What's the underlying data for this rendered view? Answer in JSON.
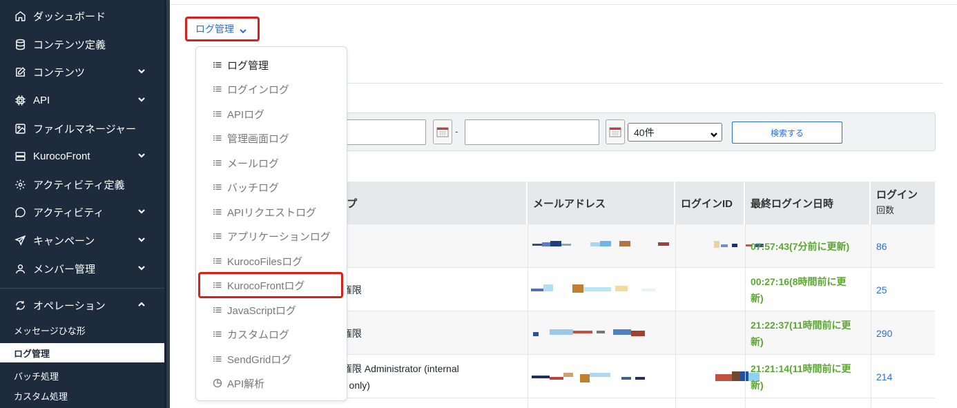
{
  "sidebar": {
    "items": [
      {
        "label": "ダッシュボード",
        "icon": "home-icon",
        "expandable": false
      },
      {
        "label": "コンテンツ定義",
        "icon": "database-icon",
        "expandable": false
      },
      {
        "label": "コンテンツ",
        "icon": "edit-icon",
        "expandable": true
      },
      {
        "label": "API",
        "icon": "chip-icon",
        "expandable": true
      },
      {
        "label": "ファイルマネージャー",
        "icon": "image-icon",
        "expandable": false
      },
      {
        "label": "KurocoFront",
        "icon": "server-icon",
        "expandable": true
      },
      {
        "label": "アクティビティ定義",
        "icon": "gear-icon",
        "expandable": false
      },
      {
        "label": "アクティビティ",
        "icon": "chat-icon",
        "expandable": true
      },
      {
        "label": "キャンペーン",
        "icon": "send-icon",
        "expandable": true
      },
      {
        "label": "メンバー管理",
        "icon": "user-icon",
        "expandable": true
      }
    ],
    "operation": {
      "label": "オペレーション",
      "icon": "refresh-icon"
    },
    "sub_items": [
      {
        "label": "メッセージひな形",
        "active": false
      },
      {
        "label": "ログ管理",
        "active": true
      },
      {
        "label": "バッチ処理",
        "active": false
      },
      {
        "label": "カスタム処理",
        "active": false
      }
    ]
  },
  "page_dropdown": {
    "label": "ログ管理"
  },
  "dropdown_menu": {
    "items": [
      {
        "label": "ログ管理",
        "icon": "list-icon",
        "current": true
      },
      {
        "label": "ログインログ",
        "icon": "list-icon"
      },
      {
        "label": "APIログ",
        "icon": "list-icon"
      },
      {
        "label": "管理画面ログ",
        "icon": "list-icon"
      },
      {
        "label": "メールログ",
        "icon": "list-icon"
      },
      {
        "label": "バッチログ",
        "icon": "list-icon"
      },
      {
        "label": "APIリクエストログ",
        "icon": "list-icon"
      },
      {
        "label": "アプリケーションログ",
        "icon": "list-icon"
      },
      {
        "label": "KurocoFilesログ",
        "icon": "list-icon"
      },
      {
        "label": "KurocoFrontログ",
        "icon": "list-icon",
        "highlighted": true
      },
      {
        "label": "JavaScriptログ",
        "icon": "list-icon"
      },
      {
        "label": "カスタムログ",
        "icon": "list-icon"
      },
      {
        "label": "SendGridログ",
        "icon": "list-icon"
      },
      {
        "label": "API解析",
        "icon": "pie-chart-icon"
      }
    ]
  },
  "filter": {
    "separator": "-",
    "per_page": "40件",
    "search_button": "検索する"
  },
  "table": {
    "headers": {
      "group": "グループ",
      "email": "メールアドレス",
      "login_id": "ログインID",
      "last_login": "最終ログイン日時",
      "login_count_1": "ログイン",
      "login_count_2": "回数"
    },
    "rows": [
      {
        "group": "",
        "last_login_1": "07:57:43(7分前に更新)",
        "last_login_2": "",
        "count": "86"
      },
      {
        "group": "編集権限",
        "last_login_1": "00:27:16(8時間前に更",
        "last_login_2": "新)",
        "count": "25"
      },
      {
        "group": "編集権限",
        "last_login_1": "21:22:37(11時間前に更",
        "last_login_2": "新)",
        "count": "290"
      },
      {
        "group": "編集権限 Administrator (internal",
        "group_2": "rk only)",
        "last_login_1": "21:21:14(11時間前に更",
        "last_login_2": "新)",
        "count": "214"
      }
    ]
  },
  "colors": {
    "sidebar_bg": "#1e2b3c",
    "accent_blue": "#2a6fd1",
    "highlight_red": "#d9201a",
    "green_text": "#5aa832"
  }
}
